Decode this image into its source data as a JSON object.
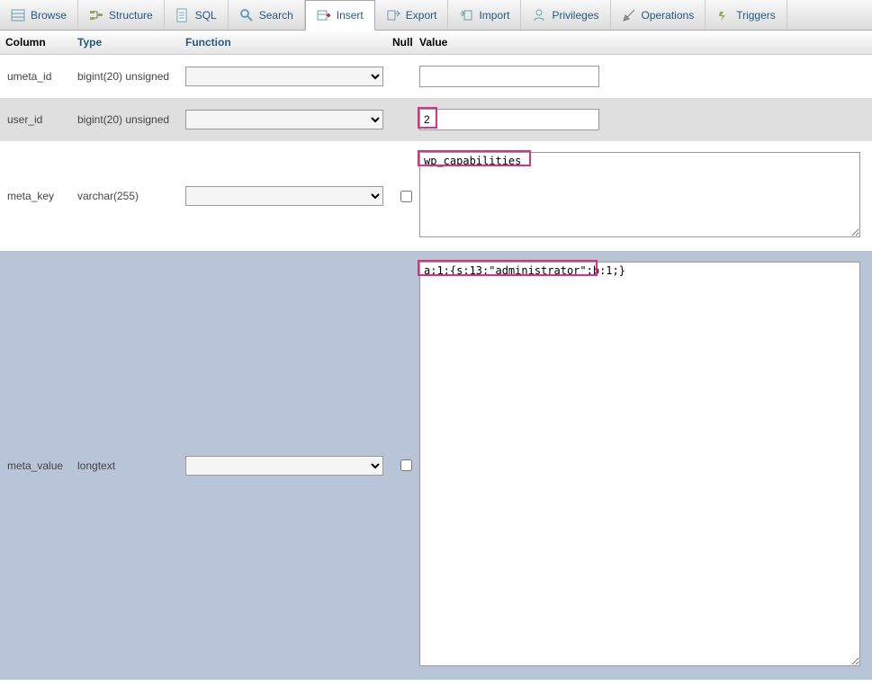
{
  "tabs": {
    "browse": "Browse",
    "structure": "Structure",
    "sql": "SQL",
    "search": "Search",
    "insert": "Insert",
    "export": "Export",
    "import": "Import",
    "privileges": "Privileges",
    "operations": "Operations",
    "triggers": "Triggers"
  },
  "headers": {
    "column": "Column",
    "type": "Type",
    "function": "Function",
    "null": "Null",
    "value": "Value"
  },
  "rows": {
    "umeta_id": {
      "name": "umeta_id",
      "type": "bigint(20) unsigned",
      "value": ""
    },
    "user_id": {
      "name": "user_id",
      "type": "bigint(20) unsigned",
      "value": "2"
    },
    "meta_key": {
      "name": "meta_key",
      "type": "varchar(255)",
      "value": "wp_capabilities"
    },
    "meta_value": {
      "name": "meta_value",
      "type": "longtext",
      "value": "a:1:{s:13:\"administrator\";b:1;}"
    }
  }
}
